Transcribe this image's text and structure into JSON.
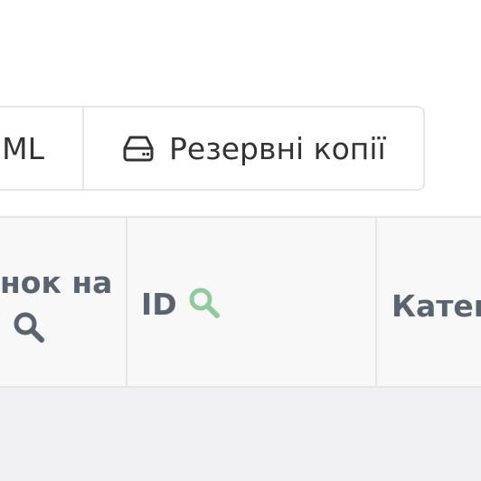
{
  "toolbar": {
    "xml_label": "ML",
    "backup_label": "Резервні копії",
    "backup_icon": "hard-drive-icon"
  },
  "table": {
    "columns": [
      {
        "label": "нок на",
        "icon": "search-icon",
        "icon_color": "#5a6370"
      },
      {
        "label": "ID",
        "icon": "search-icon",
        "icon_color": "#8fcb9b"
      },
      {
        "label": "Катег"
      }
    ]
  },
  "colors": {
    "text": "#333333",
    "header_text": "#5a6370",
    "search_active": "#8fcb9b",
    "border": "#e6e6e6"
  }
}
